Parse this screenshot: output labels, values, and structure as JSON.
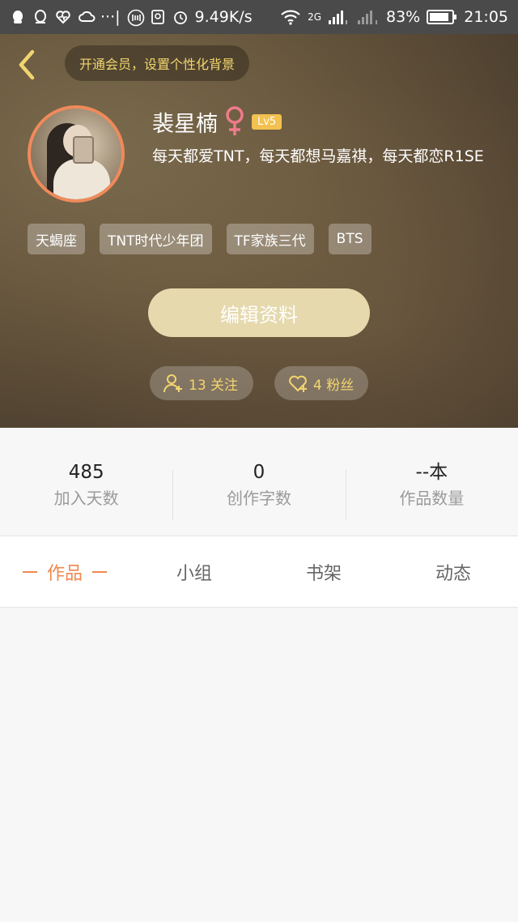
{
  "status_bar": {
    "net_speed": "9.49K/s",
    "signal_2g": "2G",
    "battery": "83%",
    "time": "21:05",
    "icons": [
      "qq-icon",
      "qq-icon",
      "health-icon",
      "cloud-icon",
      "more-icon",
      "nfc-icon",
      "vpn-icon",
      "alarm-icon",
      "wifi-icon",
      "signal-icon",
      "battery-icon"
    ]
  },
  "header": {
    "vip_prompt": "开通会员，设置个性化背景",
    "name": "裴星楠",
    "level": "Lv5",
    "bio": "每天都爱TNT，每天都想马嘉祺，每天都恋R1SE",
    "tags": [
      "天蝎座",
      "TNT时代少年团",
      "TF家族三代",
      "BTS"
    ],
    "edit_button": "编辑资料",
    "follow_text": "13 关注",
    "fans_text": "4 粉丝"
  },
  "stats": [
    {
      "value": "485",
      "label": "加入天数"
    },
    {
      "value": "0",
      "label": "创作字数"
    },
    {
      "value": "--本",
      "label": "作品数量"
    }
  ],
  "tabs": [
    {
      "label": "作品",
      "active": true
    },
    {
      "label": "小组",
      "active": false
    },
    {
      "label": "书架",
      "active": false
    },
    {
      "label": "动态",
      "active": false
    }
  ],
  "colors": {
    "accent": "#f0884e",
    "gold": "#f2d56e",
    "avatar_border": "#f08a5a",
    "edit_button_bg": "#e6d9ad",
    "level_badge": "#f2c14f",
    "gender": "#f07b8a"
  }
}
